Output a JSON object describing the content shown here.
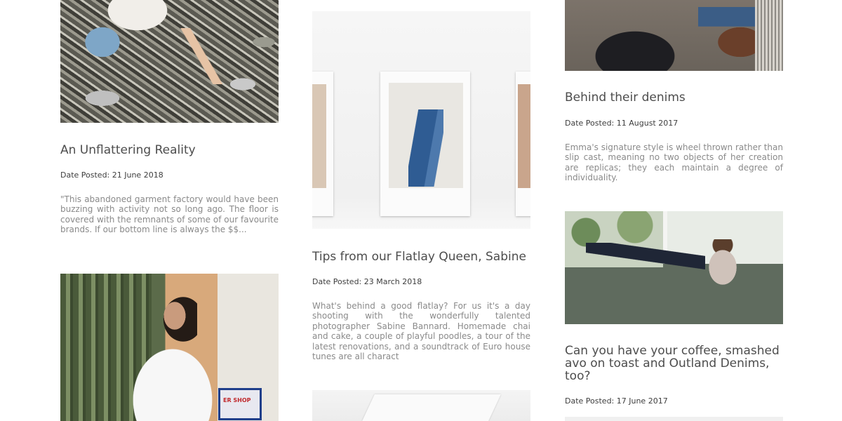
{
  "posts": [
    {
      "title": "An Unflattering Reality",
      "date": "Date Posted: 21 June 2018",
      "excerpt": "\"This abandoned garment factory would have been buzzing with activity not so long ago. The floor is covered with the remnants of some of our favourite brands. If our bottom line is always the $$..."
    },
    {
      "title": "Tips from our Flatlay Queen, Sabine",
      "date": "Date Posted: 23 March 2018",
      "excerpt": "What's behind a good flatlay? For us it's a day shooting with the wonderfully talented photographer Sabine Bannard. Homemade chai and cake, a couple of playful poodles, a tour of the latest renovations, and a soundtrack of Euro house tunes are all charact"
    },
    {
      "title": "Behind their denims",
      "date": "Date Posted: 11 August 2017",
      "excerpt": "Emma's signature style is wheel thrown rather than slip cast, meaning no two objects of her creation are replicas; they each maintain a degree of individuality."
    },
    {
      "title": "Can you have your coffee, smashed avo on toast and Outland Denims, too?",
      "date": "Date Posted: 17 June 2017"
    }
  ],
  "images": {
    "sign_text": "ER SHOP"
  }
}
